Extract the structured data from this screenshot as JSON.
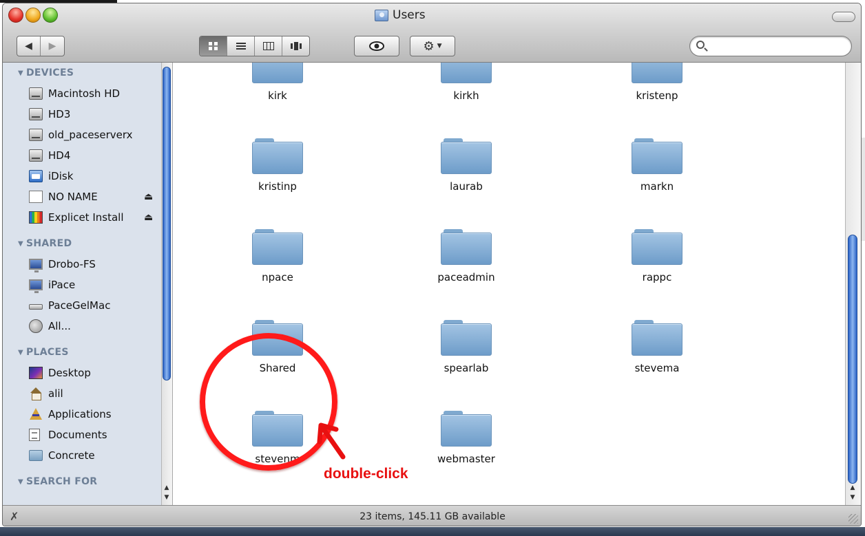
{
  "window": {
    "title": "Users"
  },
  "toolbar": {
    "search_placeholder": ""
  },
  "sidebar": {
    "sections": [
      {
        "title": "DEVICES",
        "items": [
          {
            "label": "Macintosh HD",
            "icon": "disk",
            "eject": false
          },
          {
            "label": "HD3",
            "icon": "disk",
            "eject": false
          },
          {
            "label": "old_paceserverx",
            "icon": "disk",
            "eject": false
          },
          {
            "label": "HD4",
            "icon": "disk",
            "eject": false
          },
          {
            "label": "iDisk",
            "icon": "idisk",
            "eject": false
          },
          {
            "label": "NO NAME",
            "icon": "blank",
            "eject": true
          },
          {
            "label": "Explicet Install",
            "icon": "explicet",
            "eject": true
          }
        ]
      },
      {
        "title": "SHARED",
        "items": [
          {
            "label": "Drobo-FS",
            "icon": "screen"
          },
          {
            "label": "iPace",
            "icon": "screen"
          },
          {
            "label": "PaceGelMac",
            "icon": "mini"
          },
          {
            "label": "All...",
            "icon": "network"
          }
        ]
      },
      {
        "title": "PLACES",
        "items": [
          {
            "label": "Desktop",
            "icon": "desktop"
          },
          {
            "label": "alil",
            "icon": "home"
          },
          {
            "label": "Applications",
            "icon": "apps"
          },
          {
            "label": "Documents",
            "icon": "doc"
          },
          {
            "label": "Concrete",
            "icon": "folder"
          }
        ]
      },
      {
        "title": "SEARCH FOR",
        "items": []
      }
    ]
  },
  "folders": [
    "kirk",
    "kirkh",
    "kristenp",
    "kristinp",
    "laurab",
    "markn",
    "npace",
    "paceadmin",
    "rappc",
    "Shared",
    "spearlab",
    "stevema",
    "stevenm",
    "webmaster"
  ],
  "status": {
    "text": "23 items, 145.11 GB available"
  },
  "annotation": {
    "text": "double-click",
    "color": "#e81010"
  }
}
